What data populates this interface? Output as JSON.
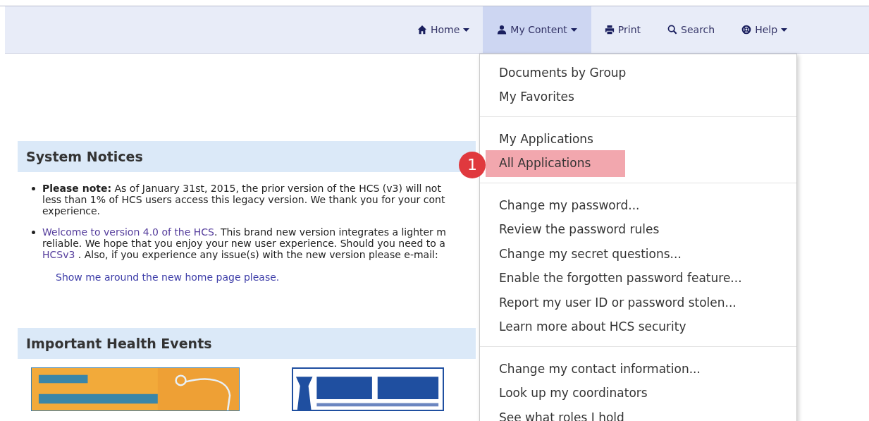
{
  "nav": [
    {
      "kind": "home",
      "label": "Home",
      "caret": true,
      "selected": false
    },
    {
      "kind": "user",
      "label": "My Content",
      "caret": true,
      "selected": true
    },
    {
      "kind": "print",
      "label": "Print",
      "caret": false,
      "selected": false
    },
    {
      "kind": "search",
      "label": "Search",
      "caret": false,
      "selected": false
    },
    {
      "kind": "help",
      "label": "Help",
      "caret": true,
      "selected": false
    }
  ],
  "dropdown": {
    "groups": [
      {
        "items": [
          {
            "label": "Documents by Group",
            "highlighted": false
          },
          {
            "label": "My Favorites",
            "highlighted": false
          }
        ]
      },
      {
        "items": [
          {
            "label": "My Applications",
            "highlighted": false
          },
          {
            "label": "All Applications",
            "highlighted": true,
            "badge": "1"
          }
        ]
      },
      {
        "items": [
          {
            "label": "Change my password...",
            "highlighted": false
          },
          {
            "label": "Review the password rules",
            "highlighted": false
          },
          {
            "label": "Change my secret questions...",
            "highlighted": false
          },
          {
            "label": "Enable the forgotten password feature...",
            "highlighted": false
          },
          {
            "label": "Report my user ID or password stolen...",
            "highlighted": false
          },
          {
            "label": "Learn more about HCS security",
            "highlighted": false
          }
        ]
      },
      {
        "items": [
          {
            "label": "Change my contact information...",
            "highlighted": false
          },
          {
            "label": "Look up my coordinators",
            "highlighted": false
          },
          {
            "label": "See what roles I hold",
            "highlighted": false
          }
        ]
      }
    ]
  },
  "system_notices": {
    "title": "System Notices",
    "items": [
      {
        "lines": [
          [
            {
              "kind": "bold",
              "text": "Please note:"
            },
            {
              "kind": "text",
              "text": " As of January 31st, 2015, the prior version of the HCS (v3) will not"
            }
          ],
          [
            {
              "kind": "text",
              "text": "less than 1% of HCS users access this legacy version. We thank you for your cont"
            }
          ],
          [
            {
              "kind": "text",
              "text": "experience."
            }
          ]
        ]
      },
      {
        "lines": [
          [
            {
              "kind": "link",
              "text": "Welcome to version 4.0 of the HCS"
            },
            {
              "kind": "text",
              "text": ". This brand new version integrates a lighter m"
            }
          ],
          [
            {
              "kind": "text",
              "text": "reliable. We hope that you enjoy your new user experience. Should you need to a"
            }
          ],
          [
            {
              "kind": "link",
              "text": "HCSv3"
            },
            {
              "kind": "text",
              "text": " . Also, if you experience any issue(s) with the new version please e-mail:"
            }
          ]
        ]
      }
    ],
    "tour_link": "Show me around the new home page please."
  },
  "health_events": {
    "title": "Important Health Events"
  }
}
